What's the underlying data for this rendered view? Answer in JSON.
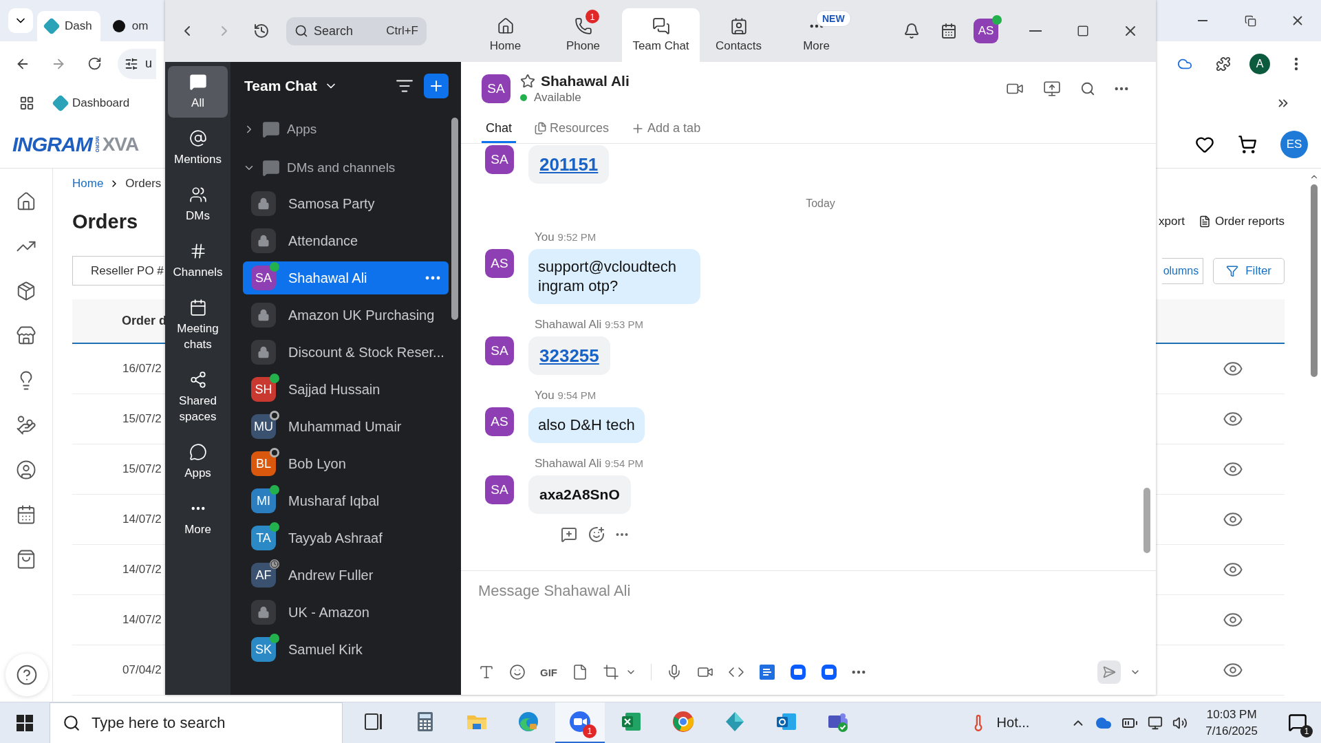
{
  "browser": {
    "tabs": [
      {
        "label": "Dash",
        "selected": true
      },
      {
        "label": "om",
        "selected": false
      }
    ],
    "address": "u",
    "profile": "A",
    "bookmarks": [
      {
        "label": "Dashboard"
      }
    ],
    "site": {
      "logo": "INGRAM",
      "logo_tag": "MICRO",
      "brand": "XVA",
      "user": "ES"
    },
    "breadcrumb": [
      {
        "label": "Home",
        "link": true
      },
      {
        "label": "Orders",
        "link": false
      }
    ],
    "title": "Orders",
    "export_link": "xport",
    "reports_link": "Order reports",
    "reseller_button": "Reseller PO #",
    "columns_button": "olumns",
    "filter_button": "Filter",
    "table": {
      "column_1": "Order d",
      "rows": [
        "16/07/2",
        "15/07/2",
        "15/07/2",
        "14/07/2",
        "14/07/2",
        "14/07/2",
        "07/04/2"
      ]
    }
  },
  "zoom": {
    "search": {
      "placeholder": "Search",
      "shortcut": "Ctrl+F"
    },
    "nav": [
      {
        "label": "Home",
        "selected": false
      },
      {
        "label": "Phone",
        "selected": false,
        "badge": "1"
      },
      {
        "label": "Team Chat",
        "selected": true
      },
      {
        "label": "Contacts",
        "selected": false
      },
      {
        "label": "More",
        "selected": false,
        "badge": "NEW"
      }
    ],
    "user": {
      "initials": "AS",
      "online": true
    },
    "rail": [
      {
        "label": "All",
        "selected": true
      },
      {
        "label": "Mentions",
        "selected": false
      },
      {
        "label": "DMs",
        "selected": false
      },
      {
        "label": "Channels",
        "selected": false
      },
      {
        "label": "Meeting chats",
        "selected": false
      },
      {
        "label": "Shared spaces",
        "selected": false
      },
      {
        "label": "Apps",
        "selected": false
      },
      {
        "label": "More",
        "selected": false
      }
    ],
    "list": {
      "title": "Team Chat",
      "sections": [
        {
          "label": "Apps",
          "expanded": false
        },
        {
          "label": "DMs and channels",
          "expanded": true,
          "items": [
            {
              "name": "Samosa Party",
              "kind": "channel",
              "selected": false
            },
            {
              "name": "Attendance",
              "kind": "channel",
              "selected": false
            },
            {
              "name": "Shahawal Ali",
              "kind": "person",
              "initials": "SA",
              "color": "#8e3fb4",
              "online": true,
              "away": false,
              "selected": true
            },
            {
              "name": "Amazon UK Purchasing",
              "kind": "channel",
              "selected": false
            },
            {
              "name": "Discount & Stock Reser...",
              "kind": "channel",
              "selected": false
            },
            {
              "name": "Sajjad Hussain",
              "kind": "person",
              "initials": "SH",
              "color": "#c9392f",
              "online": true,
              "away": false,
              "selected": false
            },
            {
              "name": "Muhammad Umair",
              "kind": "person",
              "initials": "MU",
              "color": "#3b5170",
              "online": false,
              "away": false,
              "selected": false
            },
            {
              "name": "Bob Lyon",
              "kind": "person",
              "initials": "BL",
              "color": "#d9580d",
              "online": false,
              "away": false,
              "selected": false
            },
            {
              "name": "Musharaf Iqbal",
              "kind": "person",
              "initials": "MI",
              "color": "#2b7fc1",
              "online": true,
              "away": false,
              "selected": false
            },
            {
              "name": "Tayyab Ashraaf",
              "kind": "person",
              "initials": "TA",
              "color": "#2b8ac6",
              "online": true,
              "away": false,
              "selected": false
            },
            {
              "name": "Andrew Fuller",
              "kind": "person",
              "initials": "AF",
              "color": "#3b5170",
              "online": false,
              "away": true,
              "selected": false
            },
            {
              "name": "UK - Amazon",
              "kind": "channel",
              "selected": false
            },
            {
              "name": "Samuel Kirk",
              "kind": "person",
              "initials": "SK",
              "color": "#2b8ac6",
              "online": true,
              "away": false,
              "selected": false
            }
          ]
        }
      ]
    },
    "chat": {
      "initials": "SA",
      "color": "#8e3fb4",
      "name": "Shahawal Ali",
      "status": "Available",
      "favorite": false,
      "tabs": [
        {
          "label": "Chat",
          "selected": true
        },
        {
          "label": "Resources",
          "selected": false
        }
      ],
      "add_tab": "Add a tab",
      "timeline": [
        {
          "kind": "link",
          "mine": false,
          "initials": "SA",
          "text": "201151"
        },
        {
          "kind": "divider",
          "text": "Today"
        },
        {
          "kind": "text",
          "mine": true,
          "initials": "AS",
          "sender": "You",
          "time": "9:52 PM",
          "text": "support@vcloudtech ingram otp?"
        },
        {
          "kind": "link",
          "mine": false,
          "initials": "SA",
          "sender": "Shahawal Ali",
          "time": "9:53 PM",
          "text": "323255"
        },
        {
          "kind": "text",
          "mine": true,
          "initials": "AS",
          "sender": "You",
          "time": "9:54 PM",
          "text": "also D&H tech"
        },
        {
          "kind": "bold",
          "mine": false,
          "initials": "SA",
          "sender": "Shahawal Ali",
          "time": "9:54 PM",
          "text": "axa2A8SnO"
        }
      ]
    },
    "composer": {
      "placeholder": "Message Shahawal Ali",
      "gif": "GIF"
    }
  },
  "taskbar": {
    "search_placeholder": "Type here to search",
    "apps": [
      {
        "selected": false
      },
      {
        "selected": false
      },
      {
        "selected": false
      },
      {
        "selected": false
      },
      {
        "selected": true,
        "badge": "1"
      },
      {
        "selected": false
      },
      {
        "selected": false
      },
      {
        "selected": false
      },
      {
        "selected": false
      },
      {
        "selected": false
      }
    ],
    "weather": "Hot...",
    "time": "10:03 PM",
    "date": "7/16/2025",
    "notifications": "1"
  }
}
